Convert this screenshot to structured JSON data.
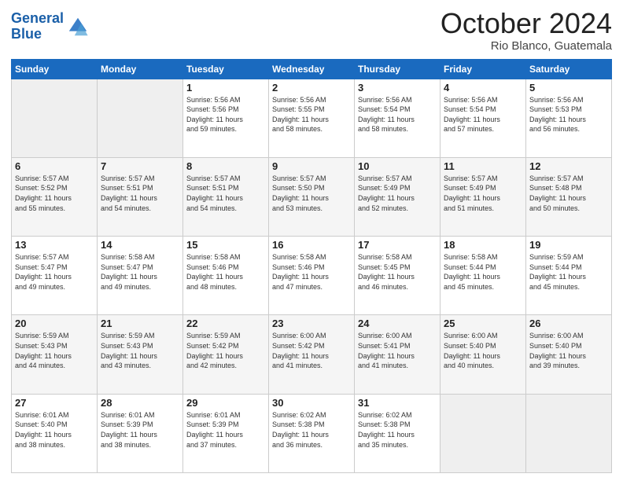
{
  "header": {
    "logo_line1": "General",
    "logo_line2": "Blue",
    "month": "October 2024",
    "location": "Rio Blanco, Guatemala"
  },
  "weekdays": [
    "Sunday",
    "Monday",
    "Tuesday",
    "Wednesday",
    "Thursday",
    "Friday",
    "Saturday"
  ],
  "weeks": [
    [
      {
        "day": "",
        "info": ""
      },
      {
        "day": "",
        "info": ""
      },
      {
        "day": "1",
        "info": "Sunrise: 5:56 AM\nSunset: 5:56 PM\nDaylight: 11 hours and 59 minutes."
      },
      {
        "day": "2",
        "info": "Sunrise: 5:56 AM\nSunset: 5:55 PM\nDaylight: 11 hours and 58 minutes."
      },
      {
        "day": "3",
        "info": "Sunrise: 5:56 AM\nSunset: 5:54 PM\nDaylight: 11 hours and 58 minutes."
      },
      {
        "day": "4",
        "info": "Sunrise: 5:56 AM\nSunset: 5:54 PM\nDaylight: 11 hours and 57 minutes."
      },
      {
        "day": "5",
        "info": "Sunrise: 5:56 AM\nSunset: 5:53 PM\nDaylight: 11 hours and 56 minutes."
      }
    ],
    [
      {
        "day": "6",
        "info": "Sunrise: 5:57 AM\nSunset: 5:52 PM\nDaylight: 11 hours and 55 minutes."
      },
      {
        "day": "7",
        "info": "Sunrise: 5:57 AM\nSunset: 5:51 PM\nDaylight: 11 hours and 54 minutes."
      },
      {
        "day": "8",
        "info": "Sunrise: 5:57 AM\nSunset: 5:51 PM\nDaylight: 11 hours and 54 minutes."
      },
      {
        "day": "9",
        "info": "Sunrise: 5:57 AM\nSunset: 5:50 PM\nDaylight: 11 hours and 53 minutes."
      },
      {
        "day": "10",
        "info": "Sunrise: 5:57 AM\nSunset: 5:49 PM\nDaylight: 11 hours and 52 minutes."
      },
      {
        "day": "11",
        "info": "Sunrise: 5:57 AM\nSunset: 5:49 PM\nDaylight: 11 hours and 51 minutes."
      },
      {
        "day": "12",
        "info": "Sunrise: 5:57 AM\nSunset: 5:48 PM\nDaylight: 11 hours and 50 minutes."
      }
    ],
    [
      {
        "day": "13",
        "info": "Sunrise: 5:57 AM\nSunset: 5:47 PM\nDaylight: 11 hours and 49 minutes."
      },
      {
        "day": "14",
        "info": "Sunrise: 5:58 AM\nSunset: 5:47 PM\nDaylight: 11 hours and 49 minutes."
      },
      {
        "day": "15",
        "info": "Sunrise: 5:58 AM\nSunset: 5:46 PM\nDaylight: 11 hours and 48 minutes."
      },
      {
        "day": "16",
        "info": "Sunrise: 5:58 AM\nSunset: 5:46 PM\nDaylight: 11 hours and 47 minutes."
      },
      {
        "day": "17",
        "info": "Sunrise: 5:58 AM\nSunset: 5:45 PM\nDaylight: 11 hours and 46 minutes."
      },
      {
        "day": "18",
        "info": "Sunrise: 5:58 AM\nSunset: 5:44 PM\nDaylight: 11 hours and 45 minutes."
      },
      {
        "day": "19",
        "info": "Sunrise: 5:59 AM\nSunset: 5:44 PM\nDaylight: 11 hours and 45 minutes."
      }
    ],
    [
      {
        "day": "20",
        "info": "Sunrise: 5:59 AM\nSunset: 5:43 PM\nDaylight: 11 hours and 44 minutes."
      },
      {
        "day": "21",
        "info": "Sunrise: 5:59 AM\nSunset: 5:43 PM\nDaylight: 11 hours and 43 minutes."
      },
      {
        "day": "22",
        "info": "Sunrise: 5:59 AM\nSunset: 5:42 PM\nDaylight: 11 hours and 42 minutes."
      },
      {
        "day": "23",
        "info": "Sunrise: 6:00 AM\nSunset: 5:42 PM\nDaylight: 11 hours and 41 minutes."
      },
      {
        "day": "24",
        "info": "Sunrise: 6:00 AM\nSunset: 5:41 PM\nDaylight: 11 hours and 41 minutes."
      },
      {
        "day": "25",
        "info": "Sunrise: 6:00 AM\nSunset: 5:40 PM\nDaylight: 11 hours and 40 minutes."
      },
      {
        "day": "26",
        "info": "Sunrise: 6:00 AM\nSunset: 5:40 PM\nDaylight: 11 hours and 39 minutes."
      }
    ],
    [
      {
        "day": "27",
        "info": "Sunrise: 6:01 AM\nSunset: 5:40 PM\nDaylight: 11 hours and 38 minutes."
      },
      {
        "day": "28",
        "info": "Sunrise: 6:01 AM\nSunset: 5:39 PM\nDaylight: 11 hours and 38 minutes."
      },
      {
        "day": "29",
        "info": "Sunrise: 6:01 AM\nSunset: 5:39 PM\nDaylight: 11 hours and 37 minutes."
      },
      {
        "day": "30",
        "info": "Sunrise: 6:02 AM\nSunset: 5:38 PM\nDaylight: 11 hours and 36 minutes."
      },
      {
        "day": "31",
        "info": "Sunrise: 6:02 AM\nSunset: 5:38 PM\nDaylight: 11 hours and 35 minutes."
      },
      {
        "day": "",
        "info": ""
      },
      {
        "day": "",
        "info": ""
      }
    ]
  ]
}
